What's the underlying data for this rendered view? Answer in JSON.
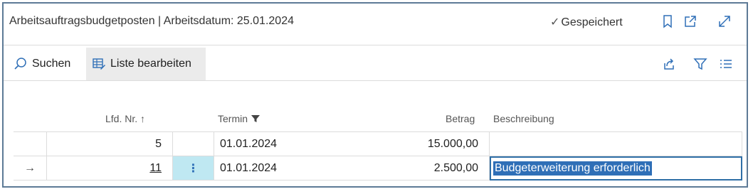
{
  "header": {
    "title": "Arbeitsauftragsbudgetposten | Arbeitsdatum: 25.01.2024",
    "saved_label": "Gespeichert"
  },
  "actions": {
    "search_label": "Suchen",
    "edit_list_label": "Liste bearbeiten"
  },
  "columns": {
    "lfd_nr": "Lfd. Nr.",
    "termin": "Termin",
    "betrag": "Betrag",
    "beschreibung": "Beschreibung"
  },
  "rows": [
    {
      "lfd_nr": "5",
      "termin": "01.01.2024",
      "betrag": "15.000,00",
      "beschreibung": ""
    },
    {
      "lfd_nr": "11",
      "termin": "01.01.2024",
      "betrag": "2.500,00",
      "beschreibung": "Budgeterweiterung erforderlich",
      "current_marker": "→"
    }
  ],
  "colors": {
    "accent": "#2f6fb7",
    "selected_cell": "#bfe8f2",
    "frame_border": "#5d7a96"
  },
  "icons": [
    "checkmark-icon",
    "bookmark-icon",
    "open-in-new-window-icon",
    "expand-icon",
    "search-icon",
    "edit-list-icon",
    "share-icon",
    "filter-icon",
    "list-view-icon",
    "sort-ascending-icon",
    "filter-funnel-icon",
    "row-menu-icon",
    "current-row-arrow-icon"
  ]
}
